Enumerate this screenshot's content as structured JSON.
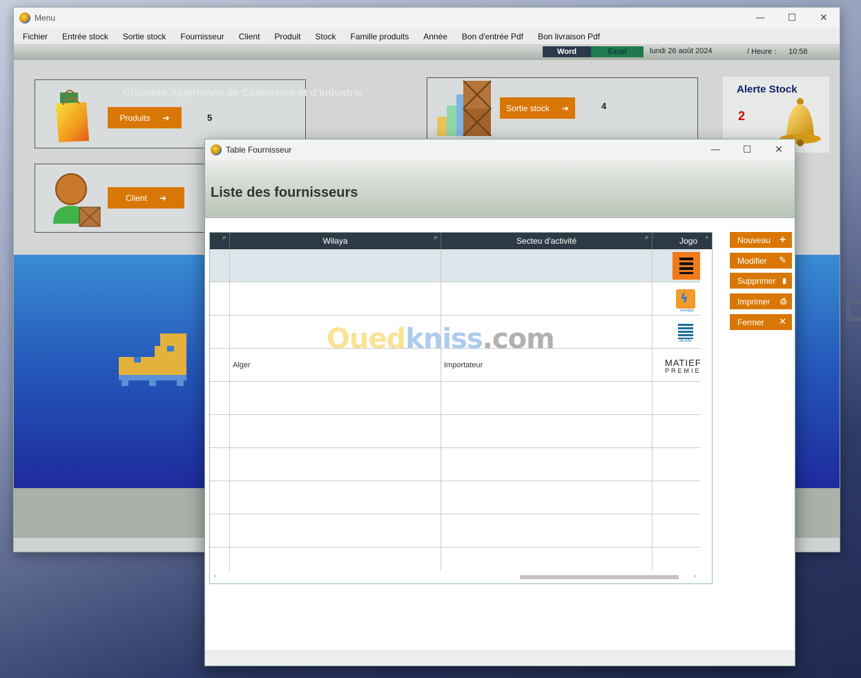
{
  "desktop": {
    "letter": "E"
  },
  "main_window": {
    "title": "Menu",
    "controls": {
      "minimize": "—",
      "maximize": "☐",
      "close": "✕"
    },
    "menu": [
      "Fichier",
      "Entrée stock",
      "Sortie stock",
      "Fournisseur",
      "Client",
      "Produit",
      "Stock",
      "Famille produits",
      "Année",
      "Bon d'entrée Pdf",
      "Bon livraison Pdf"
    ],
    "status": {
      "word": "Word",
      "excel": "Excel",
      "date": "lundi 26 août 2024",
      "heure_label": "/ Heure :",
      "heure": "10:58"
    },
    "ghost_text": "Chambre Algérienne de Commerce et d'Industrie",
    "produits": {
      "label": "Produits",
      "count": "5"
    },
    "sortie": {
      "label": "Sortie stock",
      "count": "4"
    },
    "client": {
      "label": "Client"
    },
    "alerte": {
      "title": "Alerte Stock",
      "count": "2"
    }
  },
  "dialog": {
    "title": "Table Fournisseur",
    "heading": "Liste des fournisseurs",
    "columns": [
      "Wilaya",
      "Secteu d'activité",
      "Jogo"
    ],
    "rows": [
      {
        "wilaya": "",
        "secteur": "",
        "logo": "sonatrach"
      },
      {
        "wilaya": "",
        "secteur": "",
        "logo": "sonelgaz"
      },
      {
        "wilaya": "",
        "secteur": "",
        "logo": "seaal"
      },
      {
        "wilaya": "Alger",
        "secteur": "Importateur",
        "logo": "matiere"
      },
      {
        "wilaya": "",
        "secteur": "",
        "logo": ""
      },
      {
        "wilaya": "",
        "secteur": "",
        "logo": ""
      },
      {
        "wilaya": "",
        "secteur": "",
        "logo": ""
      },
      {
        "wilaya": "",
        "secteur": "",
        "logo": ""
      },
      {
        "wilaya": "",
        "secteur": "",
        "logo": ""
      },
      {
        "wilaya": "",
        "secteur": "",
        "logo": ""
      }
    ],
    "logo_text": {
      "matiere_line1": "MATIEF",
      "matiere_line2": "PREMIE",
      "seaal": "SEAAL",
      "sonelgaz": "sonelgaz"
    },
    "buttons": {
      "nouveau": "Nouveau",
      "modifier": "Modifier",
      "supprimer": "Supprimer",
      "imprimer": "Imprimer",
      "fermer": "Fermer"
    },
    "watermark": {
      "a": "Oued",
      "b": "kniss",
      "c": ".com"
    }
  },
  "colors": {
    "accent": "#d97706",
    "header": "#2d3a45",
    "alert_red": "#d10000",
    "alert_title": "#0d1e6b"
  }
}
